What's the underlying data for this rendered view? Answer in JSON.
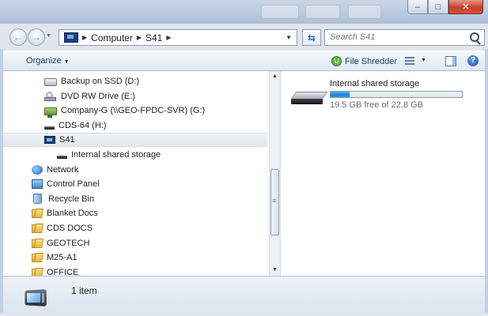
{
  "window": {
    "minimize_glyph": "‒",
    "maximize_glyph": "□",
    "close_glyph": "✕",
    "accent": "#c7412a"
  },
  "address": {
    "crumbs": [
      "Computer",
      "S41"
    ],
    "back_glyph": "←",
    "forward_glyph": "→",
    "refresh_glyph": "⇆",
    "search_placeholder": "Search S41"
  },
  "toolbar": {
    "organize_label": "Organize",
    "shredder_label": "File Shredder"
  },
  "tree": [
    {
      "label": "Backup on SSD (D:)",
      "icon": "drive-icon",
      "indent": 1
    },
    {
      "label": "DVD RW Drive (E:)",
      "icon": "dvd-drive-icon",
      "indent": 1
    },
    {
      "label": "Company-G (\\\\GEO-FPDC-SVR) (G:)",
      "icon": "network-drive-icon",
      "indent": 1
    },
    {
      "label": "CDS-64 (H:)",
      "icon": "flat-drive-icon",
      "indent": 1
    },
    {
      "label": "S41",
      "icon": "portable-device-icon",
      "indent": 1,
      "selected": true
    },
    {
      "label": "Internal shared storage",
      "icon": "flat-drive-icon",
      "indent": 2
    },
    {
      "label": "Network",
      "icon": "network-icon",
      "indent": 0
    },
    {
      "label": "Control Panel",
      "icon": "control-panel-icon",
      "indent": 0
    },
    {
      "label": "Recycle Bin",
      "icon": "recycle-bin-icon",
      "indent": 0
    },
    {
      "label": "Blanket Docs",
      "icon": "folder-icon",
      "indent": 0
    },
    {
      "label": "CDS DOCS",
      "icon": "folder-icon",
      "indent": 0
    },
    {
      "label": "GEOTECH",
      "icon": "folder-icon",
      "indent": 0
    },
    {
      "label": "M25-A1",
      "icon": "folder-icon",
      "indent": 0
    },
    {
      "label": "OFFICE",
      "icon": "folder-icon",
      "indent": 0
    }
  ],
  "storage": {
    "name": "Internal shared storage",
    "free_text": "19.5 GB free of 22.8 GB",
    "used_fraction": 0.145,
    "bar_color": "#1b84d1"
  },
  "status": {
    "count": "1 item"
  }
}
